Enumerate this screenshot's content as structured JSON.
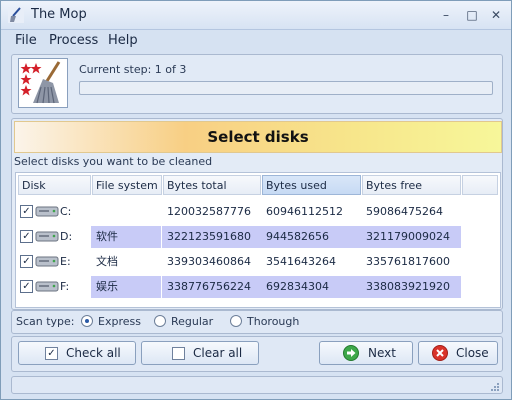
{
  "window": {
    "title": "The Mop"
  },
  "menu": [
    "File",
    "Process",
    "Help"
  ],
  "step": {
    "text": "Current step: 1 of 3",
    "progress": 0
  },
  "banner": {
    "title": "Select disks"
  },
  "hint": "Select disks you want to be cleaned",
  "table": {
    "columns": [
      "Disk",
      "File system",
      "Bytes total",
      "Bytes used",
      "Bytes free"
    ],
    "rows": [
      {
        "disk": "C:",
        "fs": "",
        "total": "120032587776",
        "used": "60946112512",
        "free": "59086475264",
        "checked": true
      },
      {
        "disk": "D:",
        "fs": "软件",
        "total": "322123591680",
        "used": "944582656",
        "free": "321179009024",
        "checked": true
      },
      {
        "disk": "E:",
        "fs": "文档",
        "total": "339303460864",
        "used": "3541643264",
        "free": "335761817600",
        "checked": true
      },
      {
        "disk": "F:",
        "fs": "娱乐",
        "total": "338776756224",
        "used": "692834304",
        "free": "338083921920",
        "checked": true
      }
    ]
  },
  "scan": {
    "label": "Scan type:",
    "options": [
      "Express",
      "Regular",
      "Thorough"
    ],
    "selected": "Express"
  },
  "buttons": {
    "check_all": "Check all",
    "clear_all": "Clear all",
    "next": "Next",
    "close": "Close"
  },
  "colors": {
    "accent": "#2b5aa6",
    "highlight": "#c8cbf7"
  }
}
